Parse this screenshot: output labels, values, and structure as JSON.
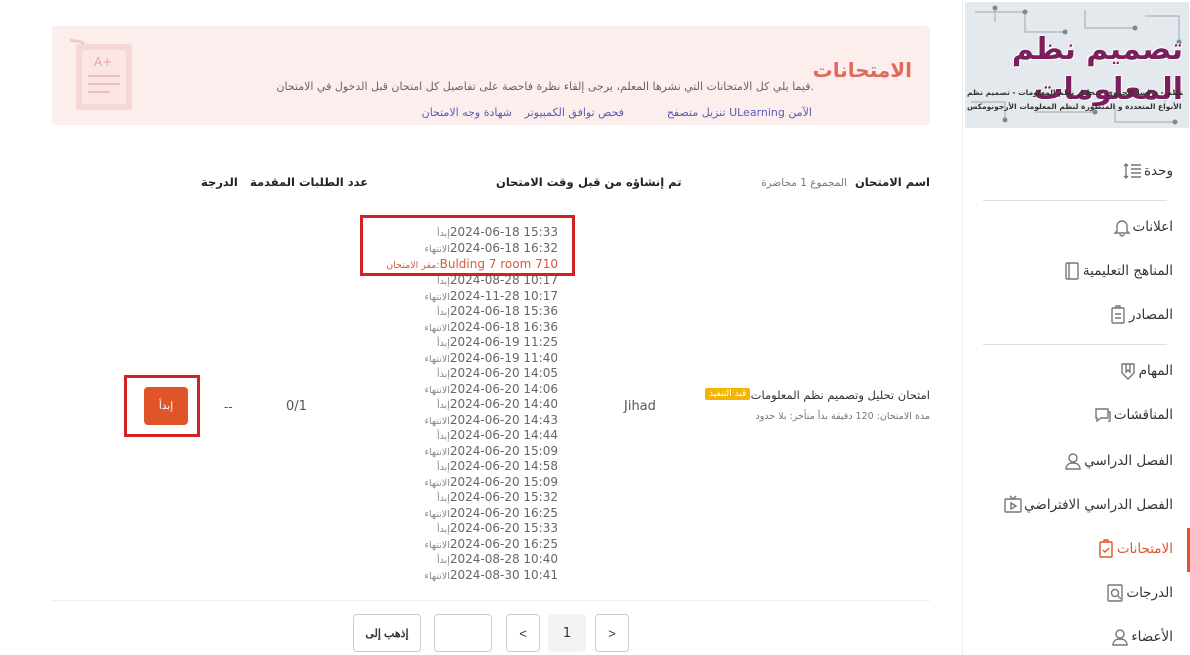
{
  "course": {
    "banner_title": "تصميم نظم المعلومات",
    "banner_line1": "نظرية النظم - دراسة الجدوى - تحليل نظم المعلومات - تصميم نظم",
    "banner_line2": "المعلومات - الأنواع المتعددة و المتطورة لنظم المعلومات الأرجونومكس"
  },
  "nav": [
    {
      "label": "وحدة",
      "icon": "list-sort-icon"
    },
    {
      "label": "اعلانات",
      "icon": "bell-icon"
    },
    {
      "label": "المناهج التعليمية",
      "icon": "book-icon"
    },
    {
      "label": "المصادر",
      "icon": "clipboard-icon"
    },
    {
      "label": "المهام",
      "icon": "shield-icon"
    },
    {
      "label": "المناقشات",
      "icon": "chat-icon"
    },
    {
      "label": "الفصل الدراسي",
      "icon": "person-icon"
    },
    {
      "label": "الفصل الدراسي الافتراضي",
      "icon": "video-icon"
    },
    {
      "label": "الامتحانات",
      "icon": "exam-icon",
      "active": true
    },
    {
      "label": "الدرجات",
      "icon": "grades-icon"
    },
    {
      "label": "الأعضاء",
      "icon": "members-icon"
    }
  ],
  "info": {
    "title": "الامتحانات",
    "description": "فيما يلي كل الامتحانات التي نشرها المعلم، يرجى إلقاء نظرة فاحصة على تفاصيل كل امتحان قبل الدخول في الامتحان.",
    "links": [
      "تنزيل متصفح ULearning الآمن",
      "فحص توافق الكمبيوتر",
      "شهادة وجه الامتحان"
    ]
  },
  "table": {
    "headers": {
      "name": "اسم الامتحان",
      "name_sub": "المجموع 1 محاضرة",
      "creator": "تم إنشاؤه من قبل",
      "time": "وقت الامتحان",
      "submissions": "عدد الطلبات المقدمة",
      "grade": "الدرجة"
    },
    "row": {
      "name": "امتحان تحليل وتصميم نظم المعلومات ...",
      "badge": "قيد التنفيذ",
      "meta": "مدة الامتحان: 120 دقيقة بدأ متأخر: بلا حدود",
      "creator": "Jihad",
      "submissions": "0/1",
      "grade": "--",
      "start_label": "إبدأ",
      "location_label": "مقر الامتحان:",
      "location": "Bulding 7 room 710",
      "times": [
        {
          "label": "إبدأ",
          "value": "2024-06-18 15:33"
        },
        {
          "label": "الانتهاء",
          "value": "2024-06-18 16:32"
        },
        {
          "label": "إبدأ",
          "value": "2024-08-28 10:17"
        },
        {
          "label": "الانتهاء",
          "value": "2024-11-28 10:17"
        },
        {
          "label": "إبدأ",
          "value": "2024-06-18 15:36"
        },
        {
          "label": "الانتهاء",
          "value": "2024-06-18 16:36"
        },
        {
          "label": "إبدأ",
          "value": "2024-06-19 11:25"
        },
        {
          "label": "الانتهاء",
          "value": "2024-06-19 11:40"
        },
        {
          "label": "إبدأ",
          "value": "2024-06-20 14:05"
        },
        {
          "label": "الانتهاء",
          "value": "2024-06-20 14:06"
        },
        {
          "label": "إبدأ",
          "value": "2024-06-20 14:40"
        },
        {
          "label": "الانتهاء",
          "value": "2024-06-20 14:43"
        },
        {
          "label": "إبدأ",
          "value": "2024-06-20 14:44"
        },
        {
          "label": "الانتهاء",
          "value": "2024-06-20 15:09"
        },
        {
          "label": "إبدأ",
          "value": "2024-06-20 14:58"
        },
        {
          "label": "الانتهاء",
          "value": "2024-06-20 15:09"
        },
        {
          "label": "إبدأ",
          "value": "2024-06-20 15:32"
        },
        {
          "label": "الانتهاء",
          "value": "2024-06-20 16:25"
        },
        {
          "label": "إبدأ",
          "value": "2024-06-20 15:33"
        },
        {
          "label": "الانتهاء",
          "value": "2024-06-20 16:25"
        },
        {
          "label": "إبدأ",
          "value": "2024-08-28 10:40"
        },
        {
          "label": "الانتهاء",
          "value": "2024-08-30 10:41"
        }
      ]
    }
  },
  "pagination": {
    "next": ">",
    "prev": "<",
    "current": "1",
    "goto_label": "إذهب إلى",
    "goto_value": ""
  },
  "colors": {
    "accent": "#e0542a",
    "highlight": "#d32020",
    "banner_bg": "#fdeeee"
  }
}
